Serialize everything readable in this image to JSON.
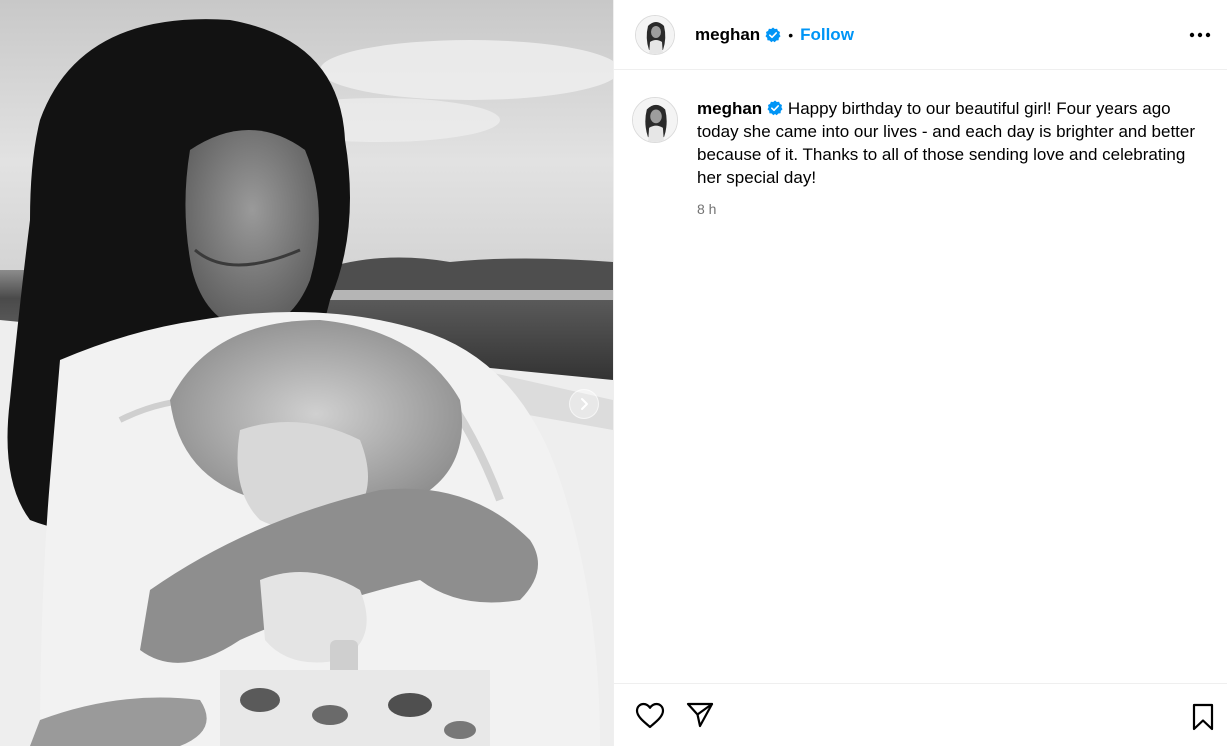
{
  "post": {
    "username": "meghan",
    "follow_label": "Follow",
    "separator": "•",
    "caption": "Happy birthday to our beautiful girl! Four years ago today she came into our lives - and each day is brighter and better because of it. Thanks to all of those sending love and celebrating her special day!",
    "timestamp": "8 h"
  },
  "icons": {
    "verified": "verified-badge-icon",
    "more": "more-options-icon",
    "next": "chevron-right-icon",
    "like": "heart-icon",
    "share": "paper-plane-icon",
    "save": "bookmark-icon"
  },
  "colors": {
    "accent": "#0095f6",
    "muted": "#737373",
    "divider": "#efefef"
  }
}
